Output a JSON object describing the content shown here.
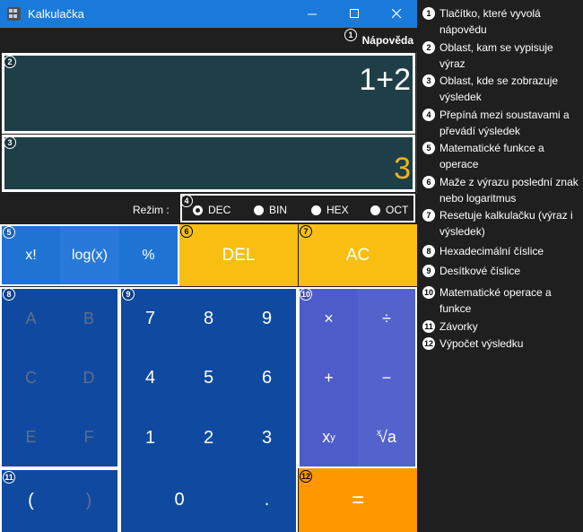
{
  "window": {
    "title": "Kalkulačka"
  },
  "help": {
    "label": "Nápověda"
  },
  "display": {
    "expression": "1+2",
    "result": "3"
  },
  "mode": {
    "label": "Režim :",
    "options": [
      "DEC",
      "BIN",
      "HEX",
      "OCT"
    ],
    "selected": "DEC"
  },
  "functions": [
    "x!",
    "log(x)",
    "%"
  ],
  "actions": {
    "del": "DEL",
    "ac": "AC"
  },
  "hex_digits": [
    "A",
    "B",
    "C",
    "D",
    "E",
    "F"
  ],
  "digits": [
    "7",
    "8",
    "9",
    "4",
    "5",
    "6",
    "1",
    "2",
    "3",
    "0",
    "."
  ],
  "operators": [
    "×",
    "÷",
    "+",
    "−"
  ],
  "power": {
    "base": "x",
    "exp": "y"
  },
  "root": {
    "index": "x",
    "symbol": "√a"
  },
  "parens": [
    "(",
    ")"
  ],
  "equals": "=",
  "markers": [
    "1",
    "2",
    "3",
    "4",
    "5",
    "6",
    "7",
    "8",
    "9",
    "10",
    "11",
    "12"
  ],
  "legend": [
    {
      "n": "1",
      "text": "Tlačítko, které vyvolá nápovědu"
    },
    {
      "n": "2",
      "text": "Oblast, kam se vypisuje výraz"
    },
    {
      "n": "3",
      "text": "Oblast, kde se zobrazuje výsledek"
    },
    {
      "n": "4",
      "text": "Přepíná mezi soustavami a převádí výsledek"
    },
    {
      "n": "5",
      "text": "Matematické funkce a operace"
    },
    {
      "n": "6",
      "text": "Maže z výrazu poslední znak nebo logaritmus"
    },
    {
      "n": "7",
      "text": "Resetuje kalkulačku (výraz i výsledek)"
    },
    {
      "n": "8",
      "text": "Hexadecimální číslice"
    },
    {
      "n": "9",
      "text": "Desítkové číslice"
    },
    {
      "n": "10",
      "text": "Matematické operace a funkce"
    },
    {
      "n": "11",
      "text": "Závorky"
    },
    {
      "n": "12",
      "text": "Výpočet výsledku"
    }
  ],
  "colors": {
    "titlebar": "#1a7ad9",
    "display": "#1e3f47",
    "result_text": "#f2b21e",
    "digits": "#0f4aa0",
    "functions": "#1f73d3",
    "actions": "#f8bf12",
    "operators": "#4b5bc8",
    "equals": "#ff9800"
  }
}
